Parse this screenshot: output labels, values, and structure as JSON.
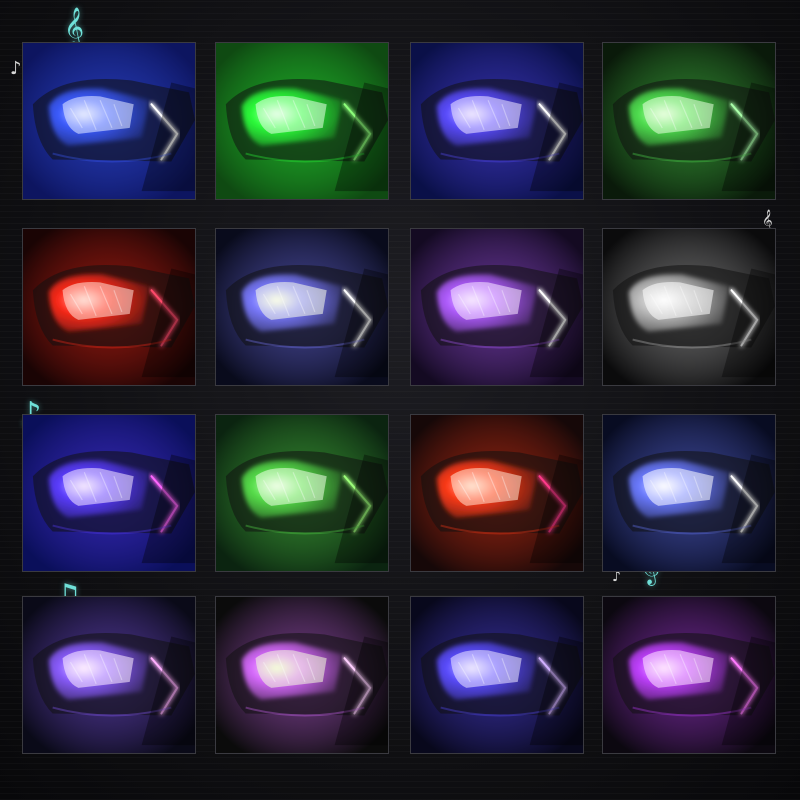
{
  "image": {
    "description_colors": {
      "background": "#0c0c0e",
      "note_accent": "#6fe0d8"
    }
  },
  "tiles": [
    {
      "label": "blue",
      "bg": "#0d1560",
      "glow": "#3b5bff",
      "core": "#e8ecff",
      "drl": "#ffffff"
    },
    {
      "label": "green",
      "bg": "#0f4a12",
      "glow": "#2bff3a",
      "core": "#eaffea",
      "drl": "#8dff7a"
    },
    {
      "label": "blue-violet",
      "bg": "#0a1048",
      "glow": "#5a4cff",
      "core": "#f1eaff",
      "drl": "#ffffff"
    },
    {
      "label": "green",
      "bg": "#0a1a0a",
      "glow": "#4fe04f",
      "core": "#eaffe0",
      "drl": "#aaffaa"
    },
    {
      "label": "red",
      "bg": "#1a0404",
      "glow": "#ff2a1a",
      "core": "#ffe2d8",
      "drl": "#ff4a6a"
    },
    {
      "label": "white-blue",
      "bg": "#090b1c",
      "glow": "#7a7aff",
      "core": "#fbffe8",
      "drl": "#ffffff"
    },
    {
      "label": "purple",
      "bg": "#140a22",
      "glow": "#b05cff",
      "core": "#f7eaff",
      "drl": "#ffffff"
    },
    {
      "label": "white",
      "bg": "#0b0b0c",
      "glow": "#bfbfbf",
      "core": "#ffffff",
      "drl": "#ffffff"
    },
    {
      "label": "blue-magenta",
      "bg": "#0a0f5a",
      "glow": "#5a3cff",
      "core": "#f6eaff",
      "drl": "#ff66ff"
    },
    {
      "label": "green",
      "bg": "#0b2410",
      "glow": "#57e04a",
      "core": "#f0ffe8",
      "drl": "#9dff7a"
    },
    {
      "label": "red",
      "bg": "#160808",
      "glow": "#ff3a18",
      "core": "#ffe6d4",
      "drl": "#ff3a8a"
    },
    {
      "label": "cool-white",
      "bg": "#080c22",
      "glow": "#6a7aff",
      "core": "#ffffff",
      "drl": "#ffffff"
    },
    {
      "label": "violet",
      "bg": "#0a0a18",
      "glow": "#8a5cff",
      "core": "#fff0ff",
      "drl": "#ffb0ff"
    },
    {
      "label": "pink-green",
      "bg": "#0b0b0b",
      "glow": "#d86aff",
      "core": "#f4ffd8",
      "drl": "#ffd0ff"
    },
    {
      "label": "indigo",
      "bg": "#08081c",
      "glow": "#5a4cff",
      "core": "#efeaff",
      "drl": "#d0b0ff"
    },
    {
      "label": "magenta",
      "bg": "#0c0810",
      "glow": "#c040ff",
      "core": "#ffe8ff",
      "drl": "#ff7aff"
    }
  ]
}
